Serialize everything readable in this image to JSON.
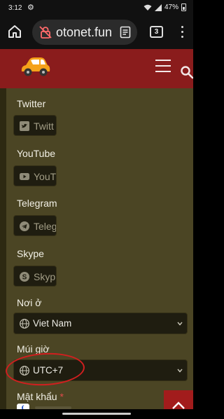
{
  "status_bar": {
    "time": "3:12",
    "battery": "47%",
    "icons": [
      "settings-gear-icon",
      "wifi-icon",
      "signal-icon",
      "battery-icon"
    ]
  },
  "browser": {
    "url": "otonet.fun",
    "tab_count": "3",
    "icons": [
      "home-icon",
      "not-secure-icon",
      "reader-mode-icon",
      "tabs-icon",
      "more-menu-icon"
    ]
  },
  "site": {
    "header_color": "#8a1c1c",
    "icons": [
      "car-logo",
      "hamburger-menu-icon",
      "search-icon"
    ]
  },
  "form": {
    "twitter": {
      "label": "Twitter",
      "placeholder": "Twitt"
    },
    "youtube": {
      "label": "YouTube",
      "placeholder": "YouT"
    },
    "telegram": {
      "label": "Telegram",
      "placeholder": "Teleg"
    },
    "skype": {
      "label": "Skype",
      "placeholder": "Skyp"
    },
    "location": {
      "label": "Nơi ở",
      "value": "Viet Nam"
    },
    "timezone": {
      "label": "Múi giờ",
      "value": "UTC+7"
    },
    "password": {
      "label": "Mật khẩu",
      "required_mark": "*"
    }
  },
  "annotation": {
    "circle_color": "#d11f1f",
    "target": "timezone-select"
  }
}
